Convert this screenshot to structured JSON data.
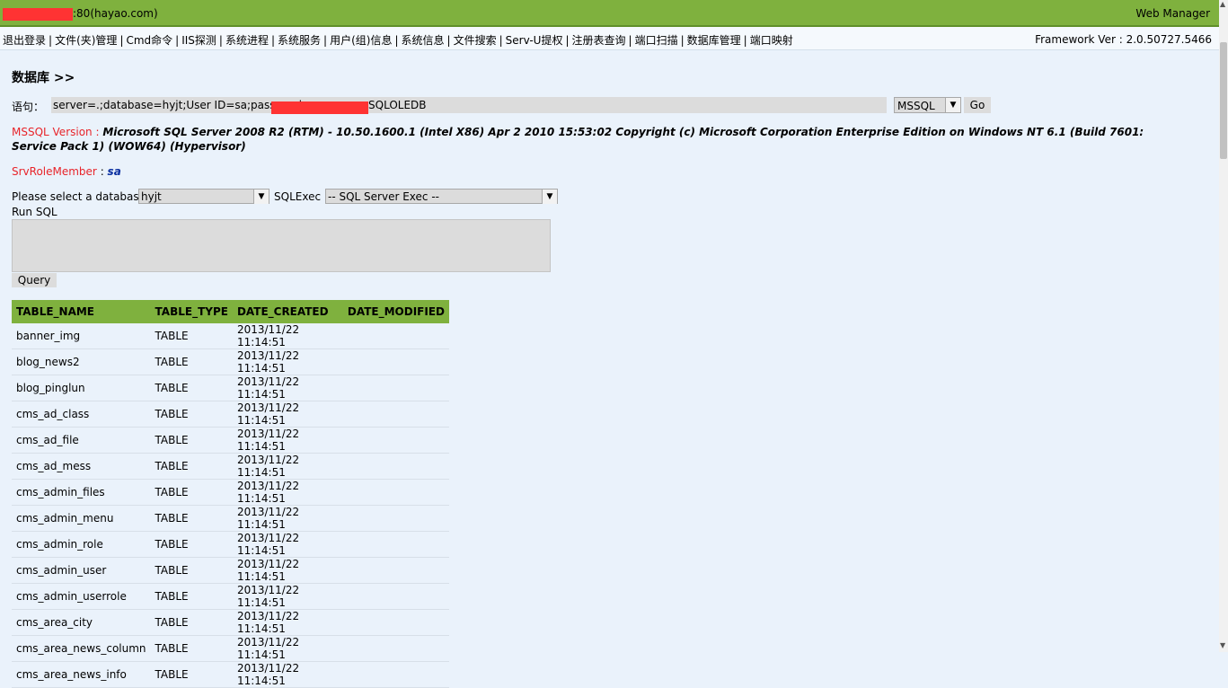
{
  "header": {
    "host": ":80(hayao.com)",
    "title": "Web Manager"
  },
  "menu": {
    "items": [
      "退出登录",
      "文件(夹)管理",
      "Cmd命令",
      "IIS探测",
      "系统进程",
      "系统服务",
      "用户(组)信息",
      "系统信息",
      "文件搜索",
      "Serv-U提权",
      "注册表查询",
      "端口扫描",
      "数据库管理",
      "端口映射"
    ],
    "framework": "Framework Ver : 2.0.50727.5466"
  },
  "page": {
    "heading": "数据库 >>",
    "conn_label": "语句：",
    "conn_value": "server=.;database=hyjt;User ID=sa;password=",
    "conn_suffix": "SQLOLEDB",
    "db_type": "MSSQL",
    "go_label": "Go",
    "version_label": "MSSQL Version",
    "version_value": "Microsoft SQL Server 2008 R2 (RTM) - 10.50.1600.1 (Intel X86) Apr 2 2010 15:53:02 Copyright (c) Microsoft Corporation Enterprise Edition on Windows NT 6.1 (Build 7601: Service Pack 1) (WOW64) (Hypervisor)",
    "role_label": "SrvRoleMember",
    "role_value": "sa",
    "db_label": "Please select a database :",
    "db_selected": "hyjt",
    "sqlexec_label": "SQLExec :",
    "sqlexec_selected": "-- SQL Server Exec --",
    "runsql_label": "Run SQL",
    "query_label": "Query"
  },
  "table": {
    "columns": [
      "TABLE_NAME",
      "TABLE_TYPE",
      "DATE_CREATED",
      "DATE_MODIFIED"
    ],
    "rows": [
      [
        "banner_img",
        "TABLE",
        "2013/11/22 11:14:51",
        ""
      ],
      [
        "blog_news2",
        "TABLE",
        "2013/11/22 11:14:51",
        ""
      ],
      [
        "blog_pinglun",
        "TABLE",
        "2013/11/22 11:14:51",
        ""
      ],
      [
        "cms_ad_class",
        "TABLE",
        "2013/11/22 11:14:51",
        ""
      ],
      [
        "cms_ad_file",
        "TABLE",
        "2013/11/22 11:14:51",
        ""
      ],
      [
        "cms_ad_mess",
        "TABLE",
        "2013/11/22 11:14:51",
        ""
      ],
      [
        "cms_admin_files",
        "TABLE",
        "2013/11/22 11:14:51",
        ""
      ],
      [
        "cms_admin_menu",
        "TABLE",
        "2013/11/22 11:14:51",
        ""
      ],
      [
        "cms_admin_role",
        "TABLE",
        "2013/11/22 11:14:51",
        ""
      ],
      [
        "cms_admin_user",
        "TABLE",
        "2013/11/22 11:14:51",
        ""
      ],
      [
        "cms_admin_userrole",
        "TABLE",
        "2013/11/22 11:14:51",
        ""
      ],
      [
        "cms_area_city",
        "TABLE",
        "2013/11/22 11:14:51",
        ""
      ],
      [
        "cms_area_news_column",
        "TABLE",
        "2013/11/22 11:14:51",
        ""
      ],
      [
        "cms_area_news_info",
        "TABLE",
        "2013/11/22 11:14:51",
        ""
      ]
    ]
  },
  "colors": {
    "header_bg": "#7fb13e",
    "page_bg": "#eaf2fb",
    "label_red": "#e8242a",
    "role_blue": "#0a2fa0"
  }
}
